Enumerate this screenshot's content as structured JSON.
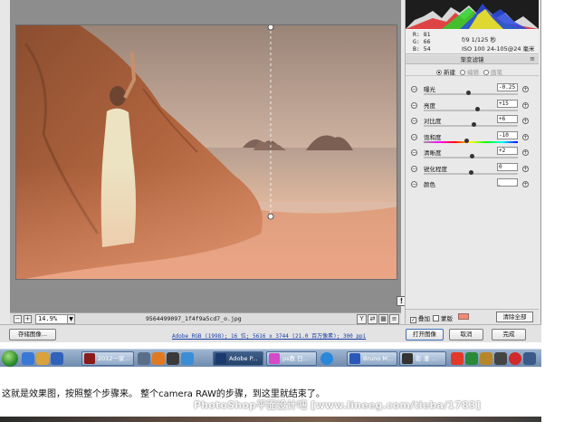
{
  "readout": {
    "r": "R:  81",
    "g": "G:  66",
    "b": "B:  54",
    "exposure_info": "f/9  1/125 秒",
    "iso_info": "ISO 100  24-105@24 毫米"
  },
  "panel": {
    "title": "渐变滤镜",
    "menu_icon": "≡",
    "modes": [
      {
        "label": "新建",
        "selected": true
      },
      {
        "label": "编辑",
        "selected": false
      },
      {
        "label": "画笔",
        "selected": false
      }
    ],
    "sliders": [
      {
        "label": "曝光",
        "value": "-0.25",
        "position": 0.47,
        "track": "plain"
      },
      {
        "label": "亮度",
        "value": "+15",
        "position": 0.57,
        "track": "plain"
      },
      {
        "label": "对比度",
        "value": "+6",
        "position": 0.53,
        "track": "plain"
      },
      {
        "label": "饱和度",
        "value": "-10",
        "position": 0.45,
        "track": "sat"
      },
      {
        "label": "清晰度",
        "value": "+2",
        "position": 0.51,
        "track": "plain"
      },
      {
        "label": "锐化程度",
        "value": "0",
        "position": 0.5,
        "track": "plain"
      }
    ],
    "color_label": "颜色",
    "overlay_label": "叠加",
    "overlay_checked": true,
    "mask_label": "蒙版",
    "mask_color": "#f08a78",
    "clear_all": "清除全部"
  },
  "zoom_bar": {
    "minus": "−",
    "plus": "+",
    "zoom": "14.9%",
    "filename": "9564499097_1f4f9a5cd7_o.jpg"
  },
  "bottom": {
    "save_image": "存储图像...",
    "workflow": "Adobe RGB (1998); 16 位; 5616 x 3744 (21.0 百万像素); 300 ppi",
    "open_image": "打开图像",
    "cancel": "取消",
    "done": "完成"
  },
  "taskbar": {
    "items": [
      {
        "label": "2012一家..."
      },
      {
        "label": "Adobe P..."
      },
      {
        "label": "ps教 日..."
      },
      {
        "label": "Bruno M..."
      },
      {
        "label": "影 潘 ..."
      }
    ]
  },
  "caption": "这就是效果图，按照整个步骤来。 整个camera RAW的步骤，到这里就结束了。",
  "watermark": "PhotoShop平面设计吧 [www.lineeg.com/tieba/1783]",
  "warning_icon": "!"
}
